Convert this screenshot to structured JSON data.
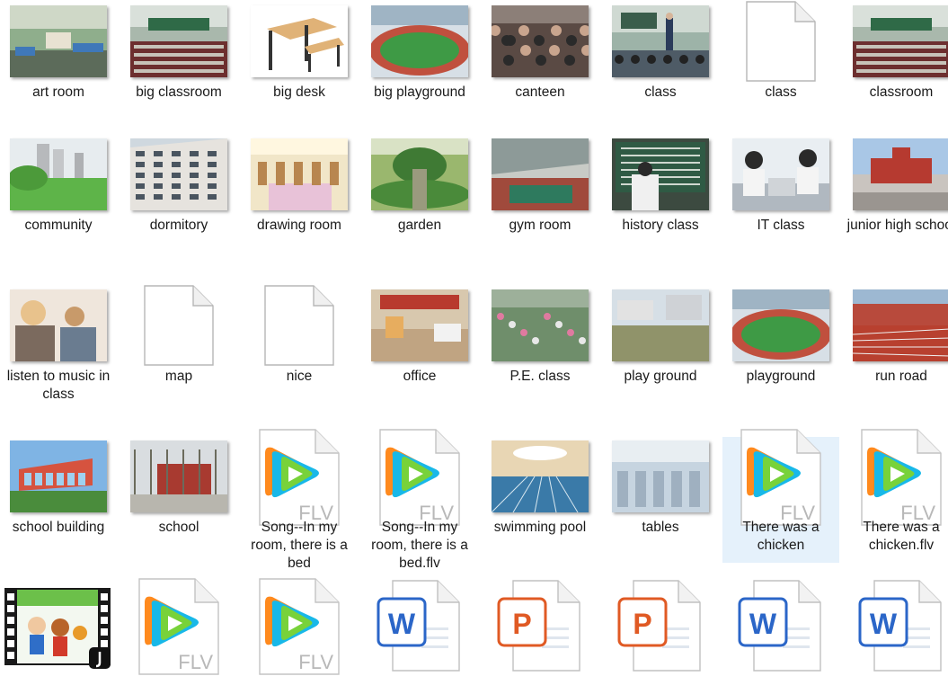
{
  "items": [
    {
      "name": "art room",
      "type": "photo",
      "scene": "artroom"
    },
    {
      "name": "big classroom",
      "type": "photo",
      "scene": "classroom"
    },
    {
      "name": "big desk",
      "type": "photo",
      "scene": "desk"
    },
    {
      "name": "big playground",
      "type": "photo",
      "scene": "field"
    },
    {
      "name": "canteen",
      "type": "photo",
      "scene": "canteen"
    },
    {
      "name": "class",
      "type": "photo",
      "scene": "class"
    },
    {
      "name": "class",
      "type": "blank"
    },
    {
      "name": "classroom",
      "type": "photo",
      "scene": "classroom"
    },
    {
      "name": "community",
      "type": "photo",
      "scene": "community"
    },
    {
      "name": "dormitory",
      "type": "photo",
      "scene": "dormitory"
    },
    {
      "name": "drawing room",
      "type": "photo",
      "scene": "drawing"
    },
    {
      "name": "garden",
      "type": "photo",
      "scene": "garden"
    },
    {
      "name": "gym room",
      "type": "photo",
      "scene": "gym"
    },
    {
      "name": "history class",
      "type": "photo",
      "scene": "history"
    },
    {
      "name": "IT class",
      "type": "photo",
      "scene": "itclass"
    },
    {
      "name": "junior high school",
      "type": "photo",
      "scene": "junior"
    },
    {
      "name": "listen to music in class",
      "type": "photo",
      "scene": "listen"
    },
    {
      "name": "map",
      "type": "blank"
    },
    {
      "name": "nice",
      "type": "blank"
    },
    {
      "name": "office",
      "type": "photo",
      "scene": "office"
    },
    {
      "name": "P.E. class",
      "type": "photo",
      "scene": "pe"
    },
    {
      "name": "play ground",
      "type": "photo",
      "scene": "playground"
    },
    {
      "name": "playground",
      "type": "photo",
      "scene": "field"
    },
    {
      "name": "run road",
      "type": "photo",
      "scene": "runroad"
    },
    {
      "name": "school building",
      "type": "photo",
      "scene": "building"
    },
    {
      "name": "school",
      "type": "photo",
      "scene": "school"
    },
    {
      "name": "Song--In my room, there is a bed",
      "type": "flv"
    },
    {
      "name": "Song--In my room, there is a bed.flv",
      "type": "flv"
    },
    {
      "name": "swimming pool",
      "type": "photo",
      "scene": "pool"
    },
    {
      "name": "tables",
      "type": "photo",
      "scene": "tables"
    },
    {
      "name": "There was a chicken",
      "type": "flv",
      "selected": true
    },
    {
      "name": "There was a chicken.flv",
      "type": "flv"
    },
    {
      "name": "",
      "type": "video"
    },
    {
      "name": "",
      "type": "flv"
    },
    {
      "name": "",
      "type": "flv"
    },
    {
      "name": "",
      "type": "word"
    },
    {
      "name": "",
      "type": "ppt"
    },
    {
      "name": "",
      "type": "ppt"
    },
    {
      "name": "",
      "type": "word"
    },
    {
      "name": "",
      "type": "word"
    }
  ],
  "icon_text": {
    "flv": "FLV",
    "word": "W",
    "ppt": "P"
  },
  "colors": {
    "selection": "#e5f1fb",
    "word_blue": "#2b66c8",
    "ppt_orange": "#e05a24",
    "flv_gray": "#b8b8b8"
  }
}
